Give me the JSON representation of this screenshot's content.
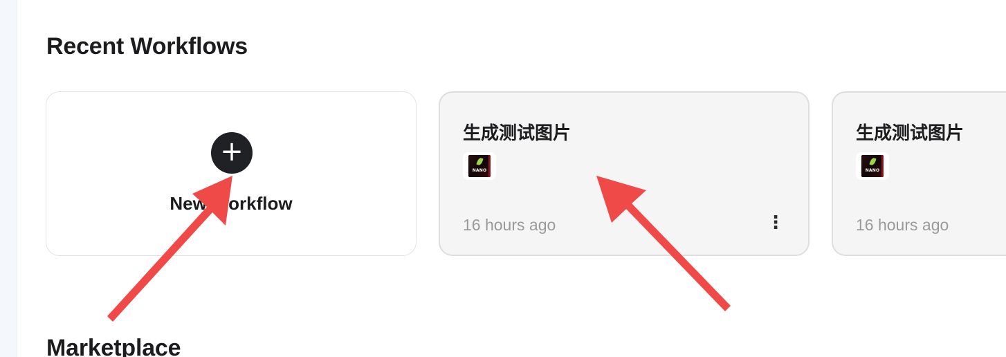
{
  "recent": {
    "title": "Recent Workflows",
    "new_card": {
      "plus_glyph": "+",
      "label": "New Workflow"
    },
    "workflows": [
      {
        "title": "生成测试图片",
        "thumb_text": "NANO",
        "time": "16 hours ago",
        "more_glyph": "⋮"
      },
      {
        "title": "生成测试图片",
        "thumb_text": "NANO",
        "time": "16 hours ago"
      }
    ]
  },
  "marketplace": {
    "title": "Marketplace"
  },
  "icons": {
    "plus": "plus-icon",
    "more": "more-vertical-icon",
    "thumbnail": "nano-thumbnail-icon"
  },
  "colors": {
    "annotation_arrow": "#f04a48",
    "plus_button_bg": "#202124",
    "card_bg": "#f5f5f5",
    "time_text": "#9a9a9a"
  }
}
